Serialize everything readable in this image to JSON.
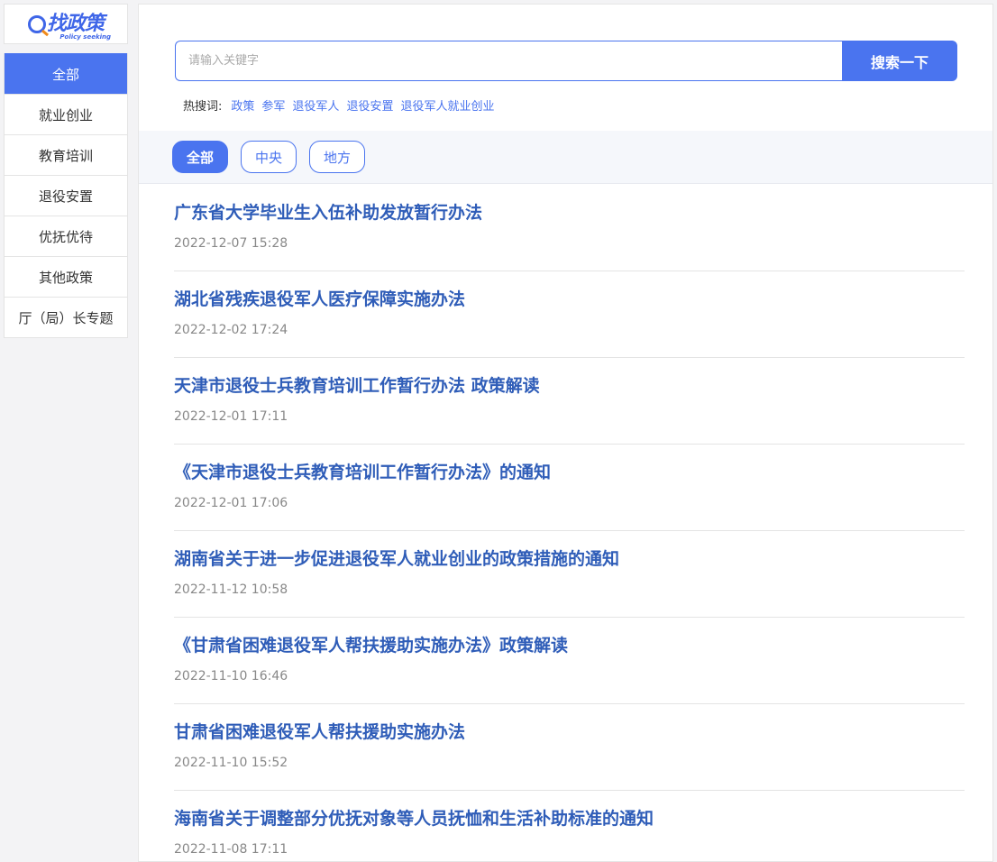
{
  "logo": {
    "text": "找政策",
    "subtitle": "Policy seeking"
  },
  "nav": {
    "items": [
      {
        "label": "全部",
        "active": true
      },
      {
        "label": "就业创业"
      },
      {
        "label": "教育培训"
      },
      {
        "label": "退役安置"
      },
      {
        "label": "优抚优待"
      },
      {
        "label": "其他政策"
      },
      {
        "label": "厅（局）长专题"
      }
    ]
  },
  "search": {
    "placeholder": "请输入关键字",
    "button": "搜索一下"
  },
  "hot": {
    "label": "热搜词:",
    "words": [
      "政策",
      "参军",
      "退役军人",
      "退役安置",
      "退役军人就业创业"
    ]
  },
  "tabs": [
    {
      "label": "全部",
      "active": true
    },
    {
      "label": "中央"
    },
    {
      "label": "地方"
    }
  ],
  "list": [
    {
      "title": "广东省大学毕业生入伍补助发放暂行办法",
      "date": "2022-12-07 15:28"
    },
    {
      "title": "湖北省残疾退役军人医疗保障实施办法",
      "date": "2022-12-02 17:24"
    },
    {
      "title": "天津市退役士兵教育培训工作暂行办法 政策解读",
      "date": "2022-12-01 17:11"
    },
    {
      "title": "《天津市退役士兵教育培训工作暂行办法》的通知",
      "date": "2022-12-01 17:06"
    },
    {
      "title": "湖南省关于进一步促进退役军人就业创业的政策措施的通知",
      "date": "2022-11-12 10:58"
    },
    {
      "title": "《甘肃省困难退役军人帮扶援助实施办法》政策解读",
      "date": "2022-11-10 16:46"
    },
    {
      "title": "甘肃省困难退役军人帮扶援助实施办法",
      "date": "2022-11-10 15:52"
    },
    {
      "title": "海南省关于调整部分优抚对象等人员抚恤和生活补助标准的通知",
      "date": "2022-11-08 17:11"
    }
  ],
  "colors": {
    "accent": "#4a74ef",
    "title": "#2f5db8",
    "logo_orange": "#f08a1c"
  }
}
